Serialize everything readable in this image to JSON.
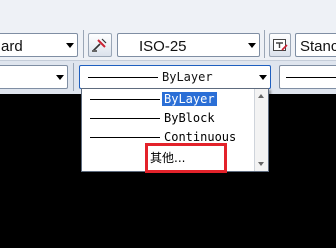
{
  "toolbar_top": {
    "layer_state_value": "ard",
    "dimstyle_value": "ISO-25",
    "textstyle_value": "Stanc",
    "dimstyle_icon": "dimension-style-icon",
    "textstyle_icon": "text-style-icon"
  },
  "toolbar_properties": {
    "linetype_value": "ByLayer"
  },
  "linetype_dropdown": {
    "options": [
      "ByLayer",
      "ByBlock",
      "Continuous",
      "其他..."
    ],
    "selected": "ByLayer"
  },
  "colors": {
    "highlight_box": "#e3222a",
    "selection": "#2b6fd6",
    "canvas": "#000000"
  }
}
